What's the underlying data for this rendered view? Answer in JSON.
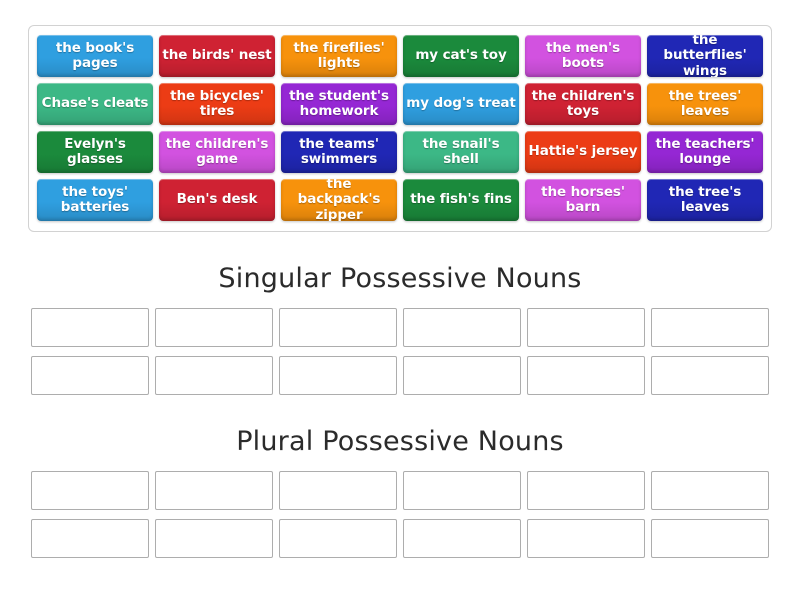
{
  "activity": {
    "type": "group-sort",
    "word_bank_rows": [
      [
        {
          "label": "the book's pages",
          "color": "#2f9fe0"
        },
        {
          "label": "the birds' nest",
          "color": "#cf2233"
        },
        {
          "label": "the fireflies' lights",
          "color": "#f7920c"
        },
        {
          "label": "my cat's toy",
          "color": "#1b8a3c"
        },
        {
          "label": "the men's boots",
          "color": "#d252e0"
        },
        {
          "label": "the butterflies' wings",
          "color": "#2027b5"
        }
      ],
      [
        {
          "label": "Chase's cleats",
          "color": "#3cb886"
        },
        {
          "label": "the bicycles' tires",
          "color": "#ec3c15"
        },
        {
          "label": "the student's homework",
          "color": "#9527d4"
        },
        {
          "label": "my dog's treat",
          "color": "#2f9fe0"
        },
        {
          "label": "the children's toys",
          "color": "#cf2233"
        },
        {
          "label": "the trees' leaves",
          "color": "#f7920c"
        }
      ],
      [
        {
          "label": "Evelyn's glasses",
          "color": "#1b8a3c"
        },
        {
          "label": "the children's game",
          "color": "#d252e0"
        },
        {
          "label": "the teams' swimmers",
          "color": "#2027b5"
        },
        {
          "label": "the snail's shell",
          "color": "#3cb886"
        },
        {
          "label": "Hattie's jersey",
          "color": "#ec3c15"
        },
        {
          "label": "the teachers' lounge",
          "color": "#9527d4"
        }
      ],
      [
        {
          "label": "the toys' batteries",
          "color": "#2f9fe0"
        },
        {
          "label": "Ben's desk",
          "color": "#cf2233"
        },
        {
          "label": "the backpack's zipper",
          "color": "#f7920c"
        },
        {
          "label": "the fish's fins",
          "color": "#1b8a3c"
        },
        {
          "label": "the horses' barn",
          "color": "#d252e0"
        },
        {
          "label": "the tree's leaves",
          "color": "#2027b5"
        }
      ]
    ],
    "categories": [
      {
        "title": "Singular Possessive Nouns",
        "slot_rows": 2,
        "slots_per_row": 6
      },
      {
        "title": "Plural Possessive Nouns",
        "slot_rows": 2,
        "slots_per_row": 6
      }
    ]
  }
}
